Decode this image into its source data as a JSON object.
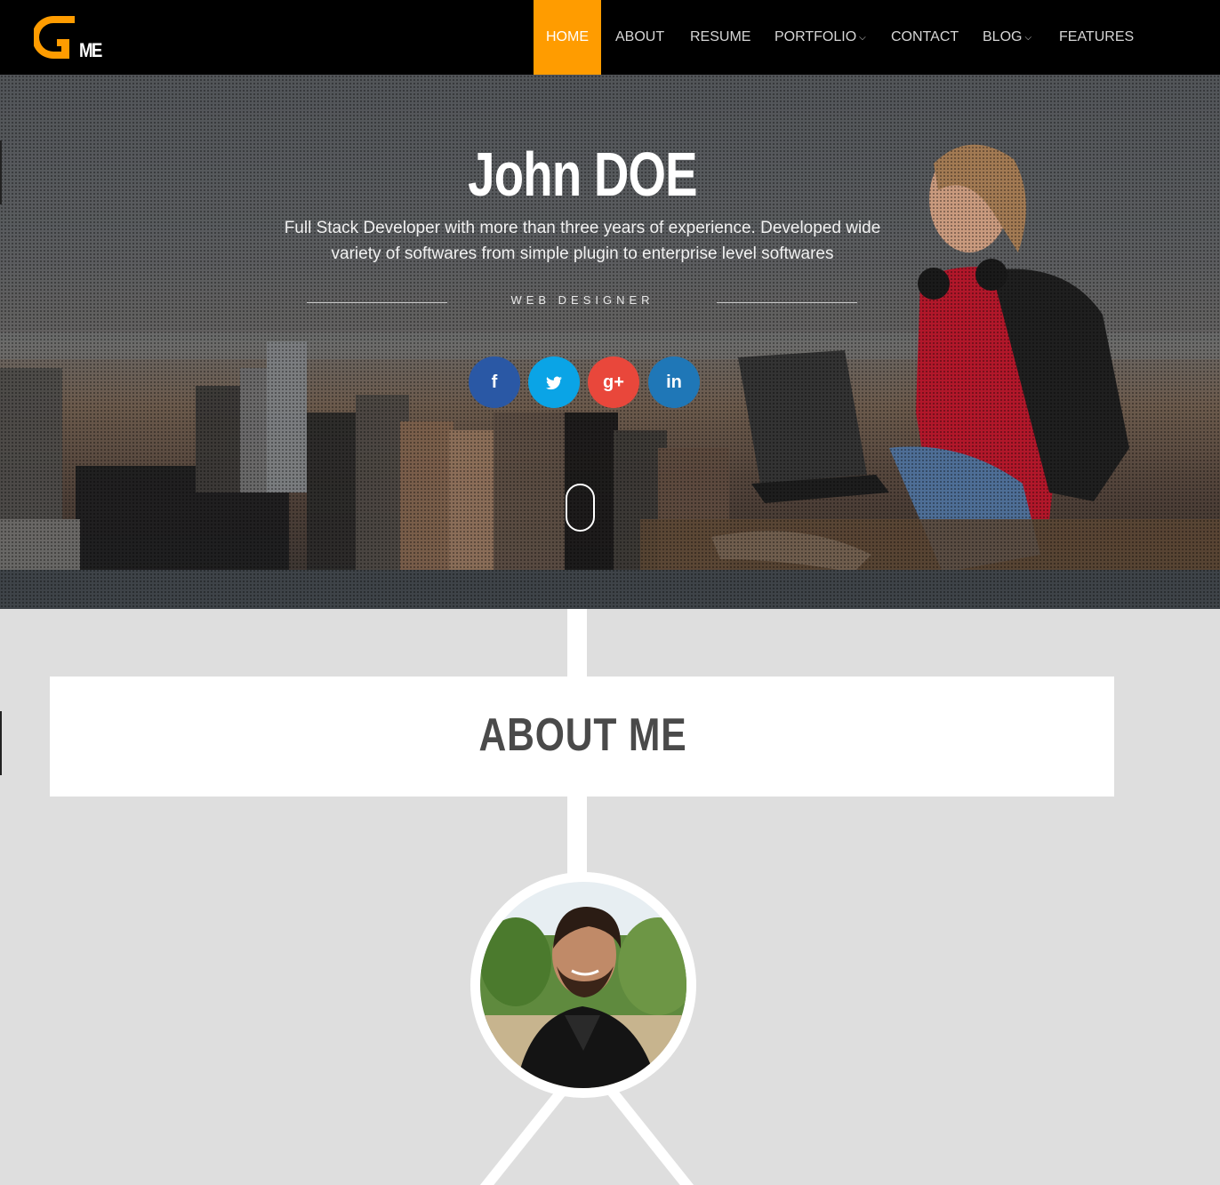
{
  "logo": {
    "mark": "G",
    "suffix": "ME"
  },
  "nav": {
    "items": [
      {
        "label": "HOME",
        "active": true
      },
      {
        "label": "ABOUT"
      },
      {
        "label": "RESUME"
      },
      {
        "label": "PORTFOLIO",
        "dropdown": true
      },
      {
        "label": "CONTACT"
      },
      {
        "label": "BLOG",
        "dropdown": true
      },
      {
        "label": "FEATURES"
      }
    ]
  },
  "hero": {
    "name": "John DOE",
    "description": "Full Stack Developer with more than three years of experience. Developed wide variety of softwares from simple plugin to enterprise level softwares",
    "role": "WEB DESIGNER",
    "social": [
      {
        "icon": "facebook-icon",
        "glyph": "f",
        "color": "#2a58a5"
      },
      {
        "icon": "twitter-icon",
        "glyph": "t",
        "color": "#0aa4e6"
      },
      {
        "icon": "google-plus-icon",
        "glyph": "g+",
        "color": "#e9473b"
      },
      {
        "icon": "linkedin-icon",
        "glyph": "in",
        "color": "#1f77b7"
      }
    ]
  },
  "about": {
    "title": "ABOUT ME"
  },
  "colors": {
    "accent": "#ff9c00",
    "navbar": "#000000",
    "page_background": "#dedede"
  }
}
